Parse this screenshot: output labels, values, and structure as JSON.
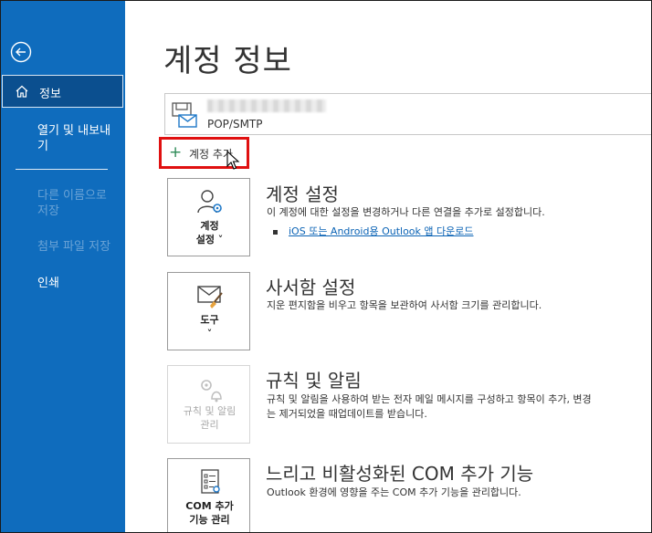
{
  "sidebar": {
    "back_icon": "back-arrow-icon",
    "items": [
      {
        "label": "정보",
        "icon": "home-icon",
        "selected": true
      },
      {
        "label": "열기 및 내보내기"
      },
      {
        "label": "다른 이름으로 저장",
        "disabled": true
      },
      {
        "label": "첨부 파일 저장",
        "disabled": true
      },
      {
        "label": "인쇄"
      }
    ],
    "color": "#0f6cbd"
  },
  "main": {
    "title": "계정 정보",
    "account": {
      "type": "POP/SMTP",
      "icon": "mail-account-icon"
    },
    "add_account_label": "계정 추가",
    "sections": [
      {
        "tile_label": "계정 설정",
        "tile_icon": "account-settings-icon",
        "title": "계정 설정",
        "description": "이 계정에 대한 설정을 변경하거나 다른 연결을 추가로 설정합니다.",
        "link": "iOS 또는 Android용 Outlook 앱 다운로드"
      },
      {
        "tile_label": "도구",
        "tile_icon": "mailbox-tools-icon",
        "title": "사서함 설정",
        "description": "지운 편지함을 비우고 항목을 보관하여 사서함 크기를 관리합니다."
      },
      {
        "tile_label": "규칙 및 알림 관리",
        "tile_icon": "rules-alerts-icon",
        "disabled": true,
        "title": "규칙 및 알림",
        "description_line1": "규칙 및 알림을 사용하여 받는 전자 메일 메시지를 구성하고 항목이 추가, 변경",
        "description_line2": "는 제거되었을 때업데이트를 받습니다."
      },
      {
        "tile_label": "COM 추가 기능 관리",
        "tile_icon": "com-addins-icon",
        "title": "느리고 비활성화된 COM 추가 기능",
        "description": "Outlook 환경에 영향을 주는 COM 추가 기능을 관리합니다."
      }
    ]
  }
}
